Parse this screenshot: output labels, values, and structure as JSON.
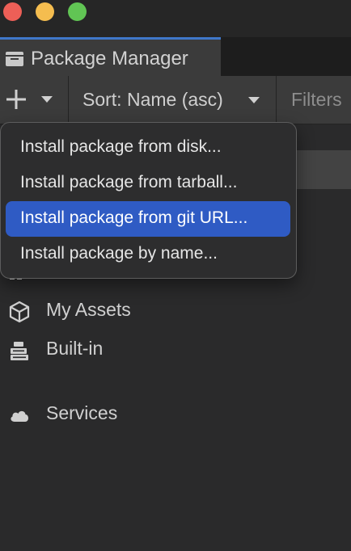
{
  "window": {
    "tab_title": "Package Manager"
  },
  "toolbar": {
    "sort_label": "Sort: Name (asc)",
    "filters_label": "Filters"
  },
  "add_menu": {
    "items": [
      {
        "label": "Install package from disk..."
      },
      {
        "label": "Install package from tarball..."
      },
      {
        "label": "Install package from git URL...",
        "highlighted": true
      },
      {
        "label": "Install package by name..."
      }
    ]
  },
  "sidebar": {
    "items": [
      {
        "label": "My Assets",
        "icon": "cube-icon"
      },
      {
        "label": "Built-in",
        "icon": "package-stack-icon"
      },
      {
        "label": "Services",
        "icon": "cloud-icon"
      }
    ]
  },
  "colors": {
    "highlight": "#2f5bc4",
    "tab_accent": "#3f77c9"
  }
}
